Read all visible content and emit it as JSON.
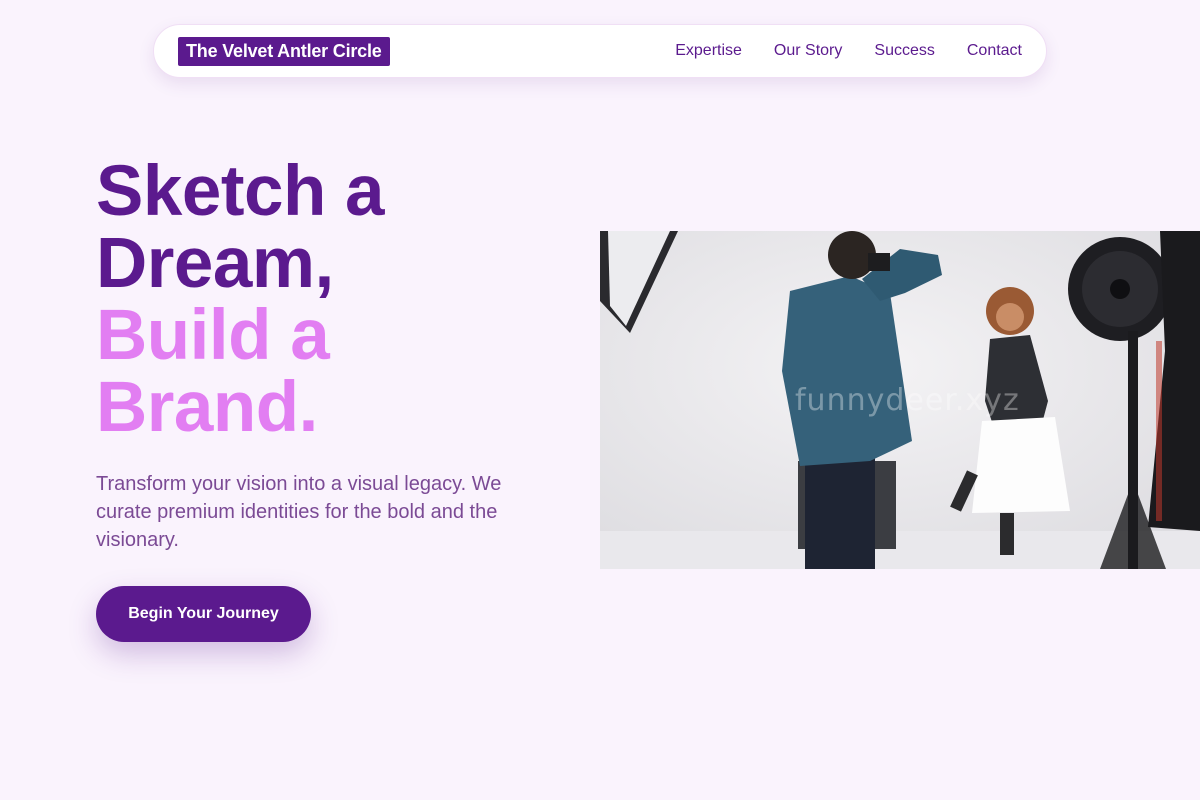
{
  "nav": {
    "brand": "The Velvet Antler Circle",
    "links": [
      "Expertise",
      "Our Story",
      "Success",
      "Contact"
    ]
  },
  "hero": {
    "title_line1": "Sketch a",
    "title_line2": "Dream,",
    "title_line3": "Build a",
    "title_line4": "Brand.",
    "subtitle": "Transform your vision into a visual legacy. We curate premium identities for the bold and the visionary.",
    "cta_label": "Begin Your Journey"
  },
  "image": {
    "description_icon": "photo-studio-image",
    "watermark": "funnydeer.xyz"
  },
  "colors": {
    "background": "#faf3fd",
    "primary": "#5b1a8e",
    "accent": "#e27ef2",
    "body_text": "#7b4a95"
  }
}
